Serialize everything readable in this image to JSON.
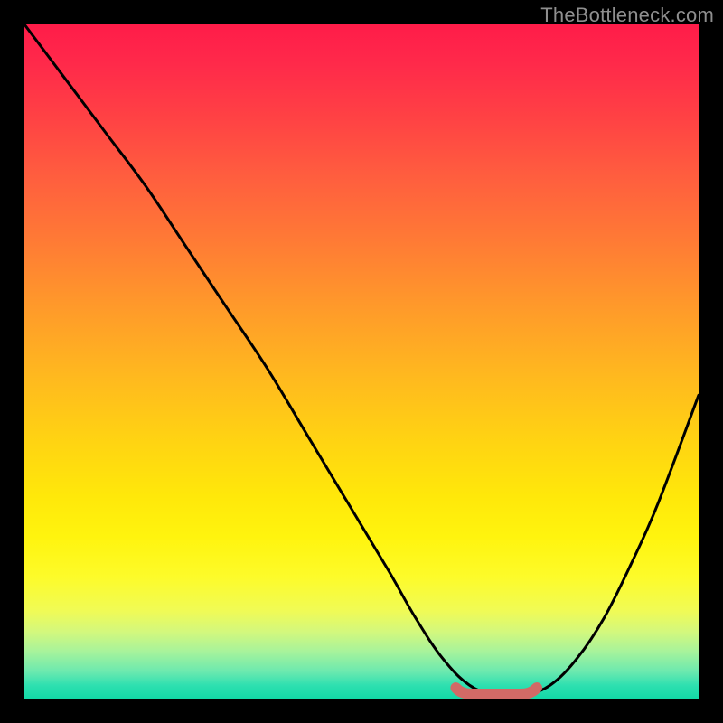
{
  "watermark": "TheBottleneck.com",
  "colors": {
    "background": "#000000",
    "curve": "#000000",
    "accent_segment": "#d26a66",
    "gradient_top": "#ff1c49",
    "gradient_bottom": "#12d8a6"
  },
  "chart_data": {
    "type": "line",
    "title": "",
    "xlabel": "",
    "ylabel": "",
    "xlim": [
      0,
      100
    ],
    "ylim": [
      0,
      100
    ],
    "grid": false,
    "legend": "none",
    "series": [
      {
        "name": "bottleneck-curve",
        "x": [
          0,
          6,
          12,
          18,
          24,
          30,
          36,
          42,
          48,
          54,
          58,
          62,
          66,
          70,
          74,
          78,
          82,
          86,
          90,
          94,
          100
        ],
        "values": [
          100,
          92,
          84,
          76,
          67,
          58,
          49,
          39,
          29,
          19,
          12,
          6,
          2,
          0.5,
          0.5,
          2,
          6,
          12,
          20,
          29,
          45
        ]
      }
    ],
    "annotations": [
      {
        "name": "flat-bottom-accent",
        "x_range": [
          64,
          76
        ],
        "y": 1.2,
        "style": "thick-rounded",
        "color": "#d26a66"
      }
    ]
  }
}
